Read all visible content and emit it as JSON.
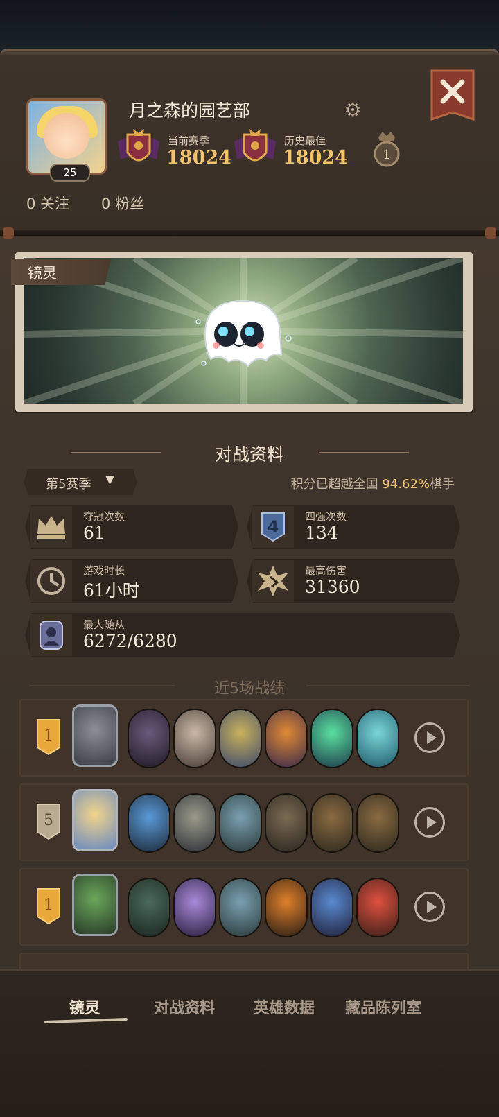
{
  "profile": {
    "username": "月之森的园艺部",
    "level": "25",
    "following": "0 关注",
    "followers": "0 粉丝",
    "current_season_label": "当前赛季",
    "current_season_score": "18024",
    "best_label": "历史最佳",
    "best_score": "18024",
    "crown_rank": "1"
  },
  "mirror": {
    "tag": "镜灵"
  },
  "battle": {
    "section_title": "对战资料",
    "season_selected": "第5赛季",
    "rank_prefix": "积分已超越全国",
    "rank_percent": "94.62%",
    "rank_suffix": "棋手",
    "stats": [
      {
        "label": "夺冠次数",
        "value": "61"
      },
      {
        "label": "四强次数",
        "value": "134"
      },
      {
        "label": "游戏时长",
        "value": "61小时"
      },
      {
        "label": "最高伤害",
        "value": "31360"
      },
      {
        "label": "最大随从",
        "value": "6272/6280"
      }
    ],
    "top4_icon_text": "4"
  },
  "recent": {
    "title": "近5场战绩",
    "matches": [
      {
        "place": "1"
      },
      {
        "place": "5"
      },
      {
        "place": "1"
      }
    ]
  },
  "nav": {
    "tabs": [
      "镜灵",
      "对战资料",
      "英雄数据",
      "藏品陈列室"
    ],
    "active": 0
  },
  "colors": {
    "gold": "#f2c36b",
    "panel": "#3f352c",
    "badge_gold": "#e8a83a"
  },
  "icons": [
    "gear-icon",
    "close-icon",
    "crown-icon",
    "clock-icon",
    "damage-icon",
    "minion-icon",
    "replay-icon",
    "ghost-icon"
  ]
}
